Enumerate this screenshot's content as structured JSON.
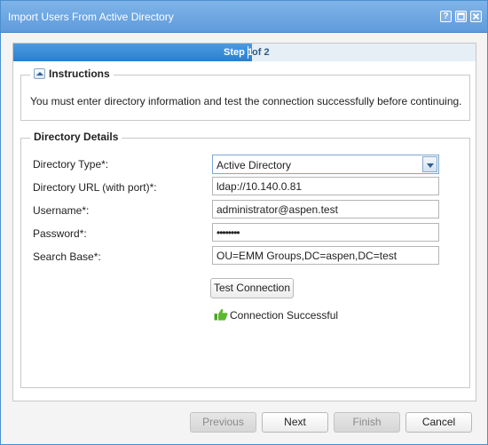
{
  "window": {
    "title": "Import Users From Active Directory",
    "controls": {
      "help": "?",
      "maximize": "",
      "close": ""
    }
  },
  "wizard": {
    "step_label": "Step 1",
    "step_of": "of 2",
    "progress": 0.5
  },
  "instructions": {
    "legend": "Instructions",
    "text": "You must enter directory information and test the connection successfully before continuing."
  },
  "directory": {
    "legend": "Directory Details",
    "fields": [
      {
        "label": "Directory Type*:",
        "value": "Active Directory",
        "type": "select"
      },
      {
        "label": "Directory URL (with port)*:",
        "value": "ldap://10.140.0.81",
        "type": "text"
      },
      {
        "label": "Username*:",
        "value": "administrator@aspen.test",
        "type": "text"
      },
      {
        "label": "Password*:",
        "value": "••••••••",
        "type": "password"
      },
      {
        "label": "Search Base*:",
        "value": "OU=EMM Groups,DC=aspen,DC=test",
        "type": "text"
      }
    ],
    "test_button": "Test Connection",
    "status_text": "Connection Successful",
    "status_icon": "thumbs-up-icon",
    "status_color": "#5cb82e"
  },
  "footer": {
    "previous": "Previous",
    "next": "Next",
    "finish": "Finish",
    "cancel": "Cancel"
  },
  "colors": {
    "titlebar": "#6ea8e2",
    "accent": "#2c7fcd"
  }
}
